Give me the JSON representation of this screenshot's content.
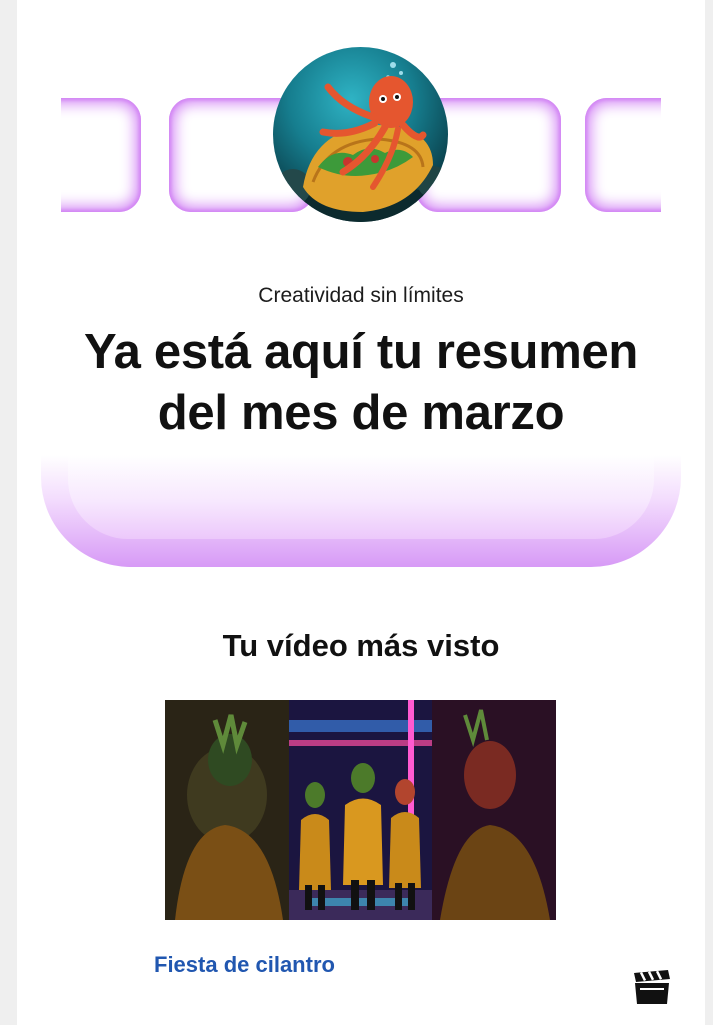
{
  "header": {
    "subtitle": "Creatividad sin límites",
    "headline": "Ya está aquí tu resumen del mes de marzo"
  },
  "avatar": {
    "icon": "octopus-taco-avatar"
  },
  "top_video": {
    "section_title": "Tu vídeo más visto",
    "title": "Fiesta de cilantro",
    "thumbnail_icon": "video-thumbnail",
    "action_icon": "clapperboard-icon"
  },
  "colors": {
    "accent_purple": "#d58cf5",
    "link_blue": "#2157b0",
    "text_dark": "#111111"
  }
}
